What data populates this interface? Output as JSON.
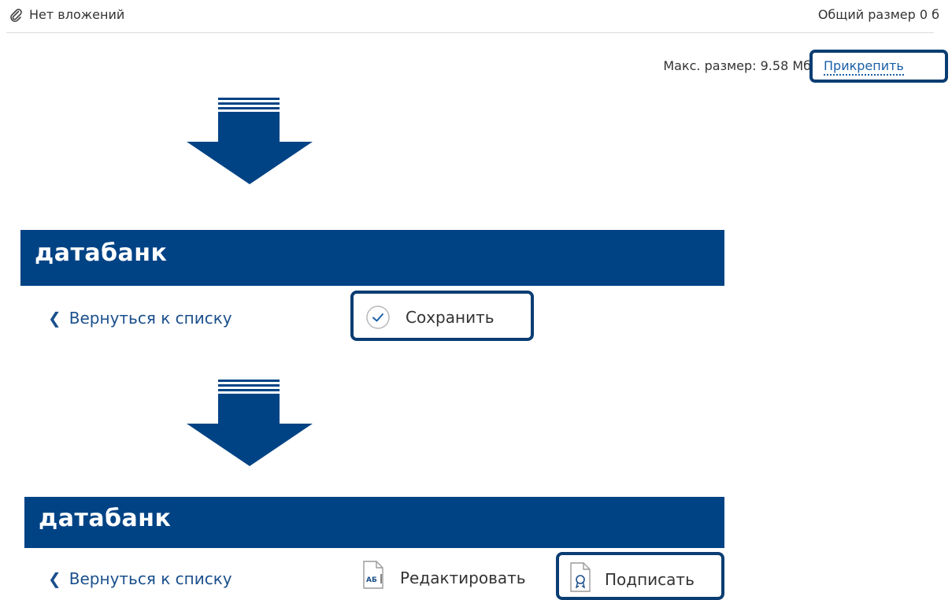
{
  "attachments": {
    "no_attachments": "Нет вложений",
    "total_size": "Общий размер 0 б",
    "max_size": "Макс. размер: 9.58 Мб",
    "attach_label": "Прикрепить"
  },
  "panel1": {
    "logo": "датабанк",
    "back_label": "Вернуться к списку",
    "save_label": "Сохранить"
  },
  "panel2": {
    "logo": "датабанк",
    "back_label": "Вернуться к списку",
    "edit_label": "Редактировать",
    "edit_icon_text": "АБ",
    "sign_label": "Подписать"
  },
  "colors": {
    "brand": "#004385",
    "highlight_border": "#0a3d72",
    "link": "#1a5fa8"
  },
  "icons": {
    "attachment": "paperclip-icon",
    "back": "chevron-left-icon",
    "save": "check-circle-icon",
    "edit": "document-text-icon",
    "sign": "certificate-icon",
    "arrow": "arrow-down-icon"
  }
}
